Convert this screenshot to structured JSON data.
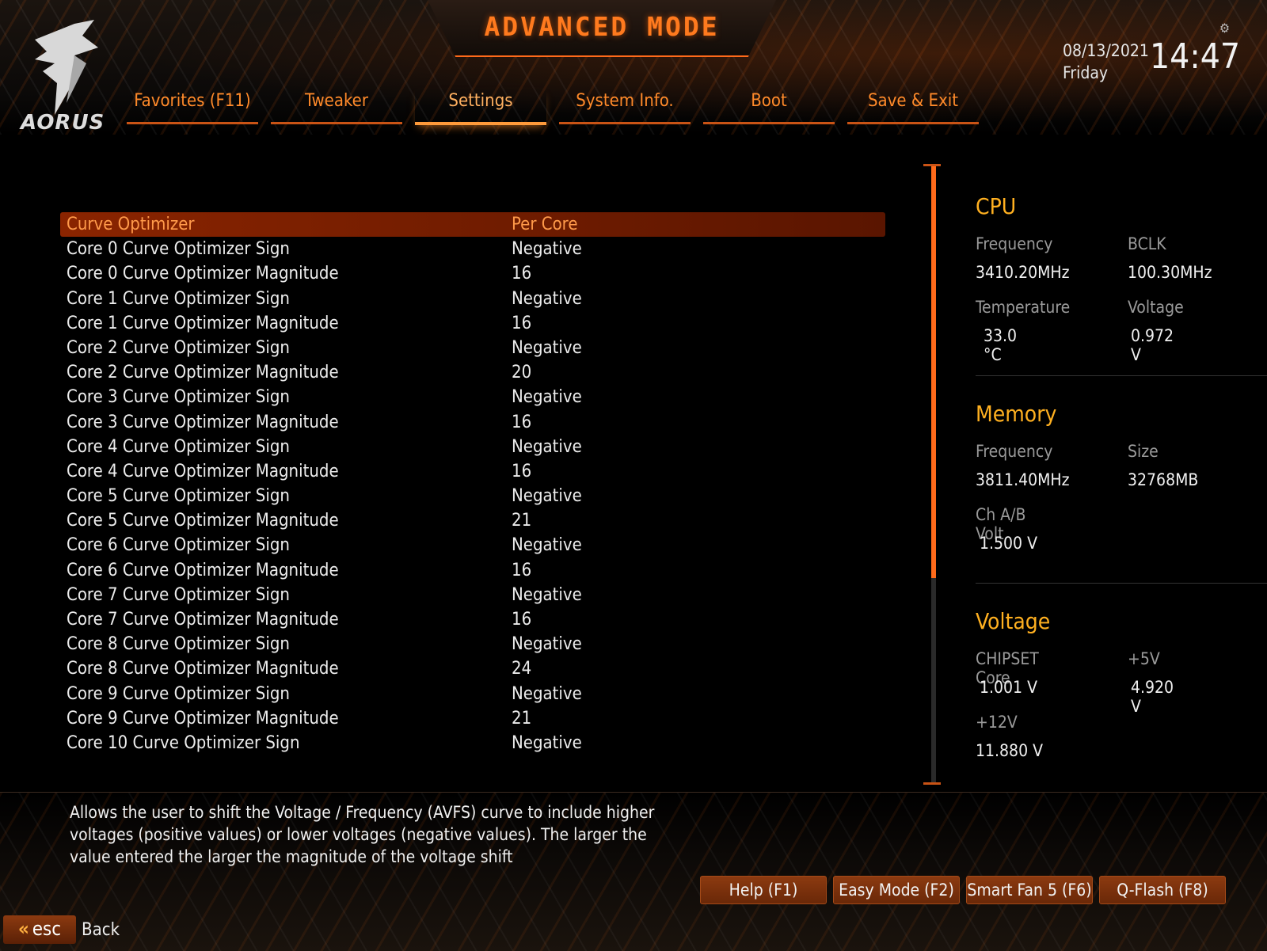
{
  "header": {
    "brand": "AORUS",
    "mode_title": "ADVANCED MODE",
    "date": "08/13/2021",
    "weekday": "Friday",
    "time": "14:47"
  },
  "tabs": [
    {
      "label": "Favorites (F11)",
      "active": false
    },
    {
      "label": "Tweaker",
      "active": false
    },
    {
      "label": "Settings",
      "active": true
    },
    {
      "label": "System Info.",
      "active": false
    },
    {
      "label": "Boot",
      "active": false
    },
    {
      "label": "Save & Exit",
      "active": false
    }
  ],
  "settings": [
    {
      "label": "Curve Optimizer",
      "value": "Per Core",
      "selected": true
    },
    {
      "label": "Core 0 Curve Optimizer Sign",
      "value": "Negative"
    },
    {
      "label": "Core 0 Curve Optimizer Magnitude",
      "value": "16"
    },
    {
      "label": "Core 1 Curve Optimizer Sign",
      "value": "Negative"
    },
    {
      "label": "Core 1 Curve Optimizer Magnitude",
      "value": "16"
    },
    {
      "label": "Core 2 Curve Optimizer Sign",
      "value": "Negative"
    },
    {
      "label": "Core 2 Curve Optimizer Magnitude",
      "value": "20"
    },
    {
      "label": "Core 3 Curve Optimizer Sign",
      "value": "Negative"
    },
    {
      "label": "Core 3 Curve Optimizer Magnitude",
      "value": "16"
    },
    {
      "label": "Core 4 Curve Optimizer Sign",
      "value": "Negative"
    },
    {
      "label": "Core 4 Curve Optimizer Magnitude",
      "value": "16"
    },
    {
      "label": "Core 5 Curve Optimizer Sign",
      "value": "Negative"
    },
    {
      "label": "Core 5 Curve Optimizer Magnitude",
      "value": "21"
    },
    {
      "label": "Core 6 Curve Optimizer Sign",
      "value": "Negative"
    },
    {
      "label": "Core 6 Curve Optimizer Magnitude",
      "value": "16"
    },
    {
      "label": "Core 7 Curve Optimizer Sign",
      "value": "Negative"
    },
    {
      "label": "Core 7 Curve Optimizer Magnitude",
      "value": "16"
    },
    {
      "label": "Core 8 Curve Optimizer Sign",
      "value": "Negative"
    },
    {
      "label": "Core 8 Curve Optimizer Magnitude",
      "value": "24"
    },
    {
      "label": "Core 9 Curve Optimizer Sign",
      "value": "Negative"
    },
    {
      "label": "Core 9 Curve Optimizer Magnitude",
      "value": "21"
    },
    {
      "label": "Core 10 Curve Optimizer Sign",
      "value": "Negative"
    }
  ],
  "sidebar": {
    "cpu": {
      "title": "CPU",
      "frequency_label": "Frequency",
      "frequency": "3410.20MHz",
      "bclk_label": "BCLK",
      "bclk": "100.30MHz",
      "temperature_label": "Temperature",
      "temperature": "33.0 °C",
      "voltage_label": "Voltage",
      "voltage": "0.972 V"
    },
    "memory": {
      "title": "Memory",
      "frequency_label": "Frequency",
      "frequency": "3811.40MHz",
      "size_label": "Size",
      "size": "32768MB",
      "chab_volt_label": "Ch A/B Volt",
      "chab_volt": "1.500 V"
    },
    "voltage": {
      "title": "Voltage",
      "chipset_label": "CHIPSET Core",
      "chipset": "1.001 V",
      "p5v_label": "+5V",
      "p5v": "4.920 V",
      "p12v_label": "+12V",
      "p12v": "11.880 V"
    }
  },
  "description": "Allows the user to shift the Voltage / Frequency (AVFS) curve to include higher voltages (positive values) or lower voltages (negative values). The larger the value entered the larger the magnitude of the voltage shift",
  "footer": {
    "buttons": [
      "Help (F1)",
      "Easy Mode (F2)",
      "Smart Fan 5 (F6)",
      "Q-Flash (F8)"
    ],
    "esc_label": "esc",
    "back_label": "Back"
  },
  "colors": {
    "accent": "#ff6a1a",
    "section_title": "#ffb020",
    "selected_row": "#8a2400"
  }
}
